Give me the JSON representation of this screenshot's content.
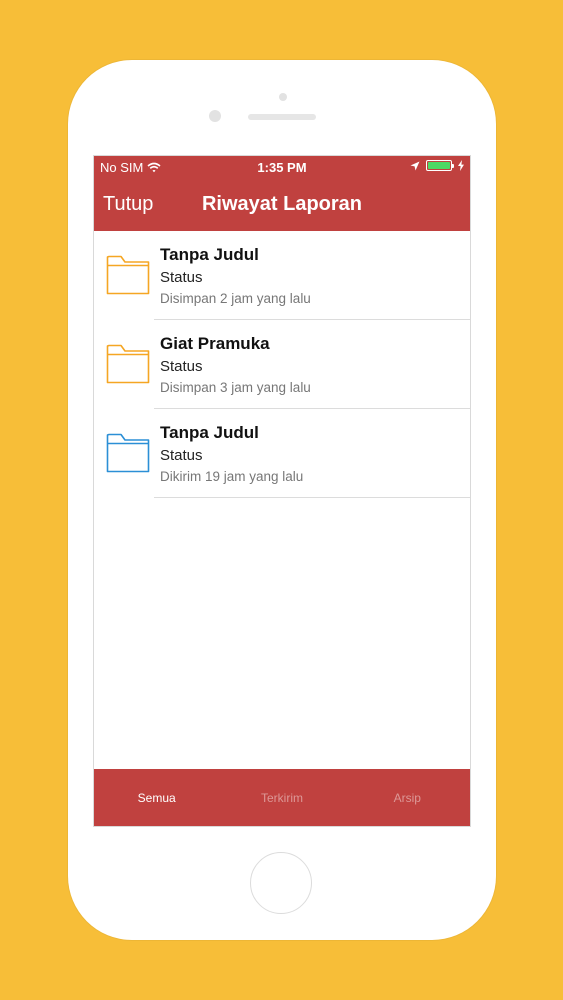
{
  "status_bar": {
    "carrier": "No SIM",
    "time": "1:35 PM",
    "battery_fill": 1.0
  },
  "nav": {
    "close_label": "Tutup",
    "title": "Riwayat Laporan"
  },
  "reports": [
    {
      "title": "Tanpa Judul",
      "status": "Status",
      "time": "Disimpan 2 jam yang lalu",
      "folder_color": "#F5A623"
    },
    {
      "title": "Giat Pramuka",
      "status": "Status",
      "time": "Disimpan 3 jam yang lalu",
      "folder_color": "#F5A623"
    },
    {
      "title": "Tanpa Judul",
      "status": "Status",
      "time": "Dikirim 19 jam yang lalu",
      "folder_color": "#2B8FD6"
    }
  ],
  "tabs": [
    {
      "label": "Semua",
      "active": true
    },
    {
      "label": "Terkirim",
      "active": false
    },
    {
      "label": "Arsip",
      "active": false
    }
  ],
  "colors": {
    "background": "#F7BE38",
    "accent": "#C0413F",
    "battery": "#4CD964"
  },
  "icons": [
    "wifi-icon",
    "location-arrow-icon",
    "battery-icon",
    "charging-bolt-icon",
    "folder-icon"
  ]
}
